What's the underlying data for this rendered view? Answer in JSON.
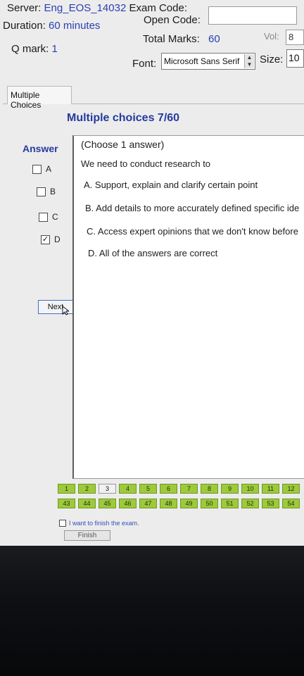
{
  "header": {
    "server_label": "Server:",
    "server_value": "Eng_EOS_14032",
    "exam_code_label": "Exam Code:",
    "duration_label": "Duration:",
    "duration_value": "60 minutes",
    "open_code_label": "Open Code:",
    "open_code_value": "",
    "qmark_label": "Q mark:",
    "qmark_value": "1",
    "total_marks_label": "Total Marks:",
    "total_marks_value": "60",
    "vol_label": "Vol:",
    "vol_value": "8",
    "font_label": "Font:",
    "font_value": "Microsoft Sans Serif",
    "size_label": "Size:",
    "size_value": "10"
  },
  "tab": {
    "label": "Multiple Choices"
  },
  "question": {
    "title": "Multiple choices 7/60",
    "answer_label": "Answer",
    "instruction": "(Choose 1 answer)",
    "stem": "We need to conduct research to",
    "options": [
      "A.  Support, explain and clarify certain point",
      "B.  Add details to more accurately defined specific ide",
      "C.  Access expert opinions that we don't know before",
      "D.  All of the answers are correct"
    ]
  },
  "answer_choices": [
    {
      "letter": "A",
      "checked": false,
      "mark": ""
    },
    {
      "letter": "B",
      "checked": false,
      "mark": ""
    },
    {
      "letter": "C",
      "checked": false,
      "mark": ""
    },
    {
      "letter": "D",
      "checked": true,
      "mark": "✓"
    }
  ],
  "next_button": "Next",
  "question_numbers": {
    "row1": [
      "1",
      "2",
      "3",
      "4",
      "5",
      "6",
      "7",
      "8",
      "9",
      "10",
      "11",
      "12"
    ],
    "row2": [
      "43",
      "44",
      "45",
      "46",
      "47",
      "48",
      "49",
      "50",
      "51",
      "52",
      "53",
      "54"
    ],
    "active": "3"
  },
  "finish": {
    "checkbox_label": "I want to finish the exam.",
    "button_label": "Finish"
  },
  "colors": {
    "accent_blue": "#263a9e",
    "answered_green": "#9ec93c"
  }
}
